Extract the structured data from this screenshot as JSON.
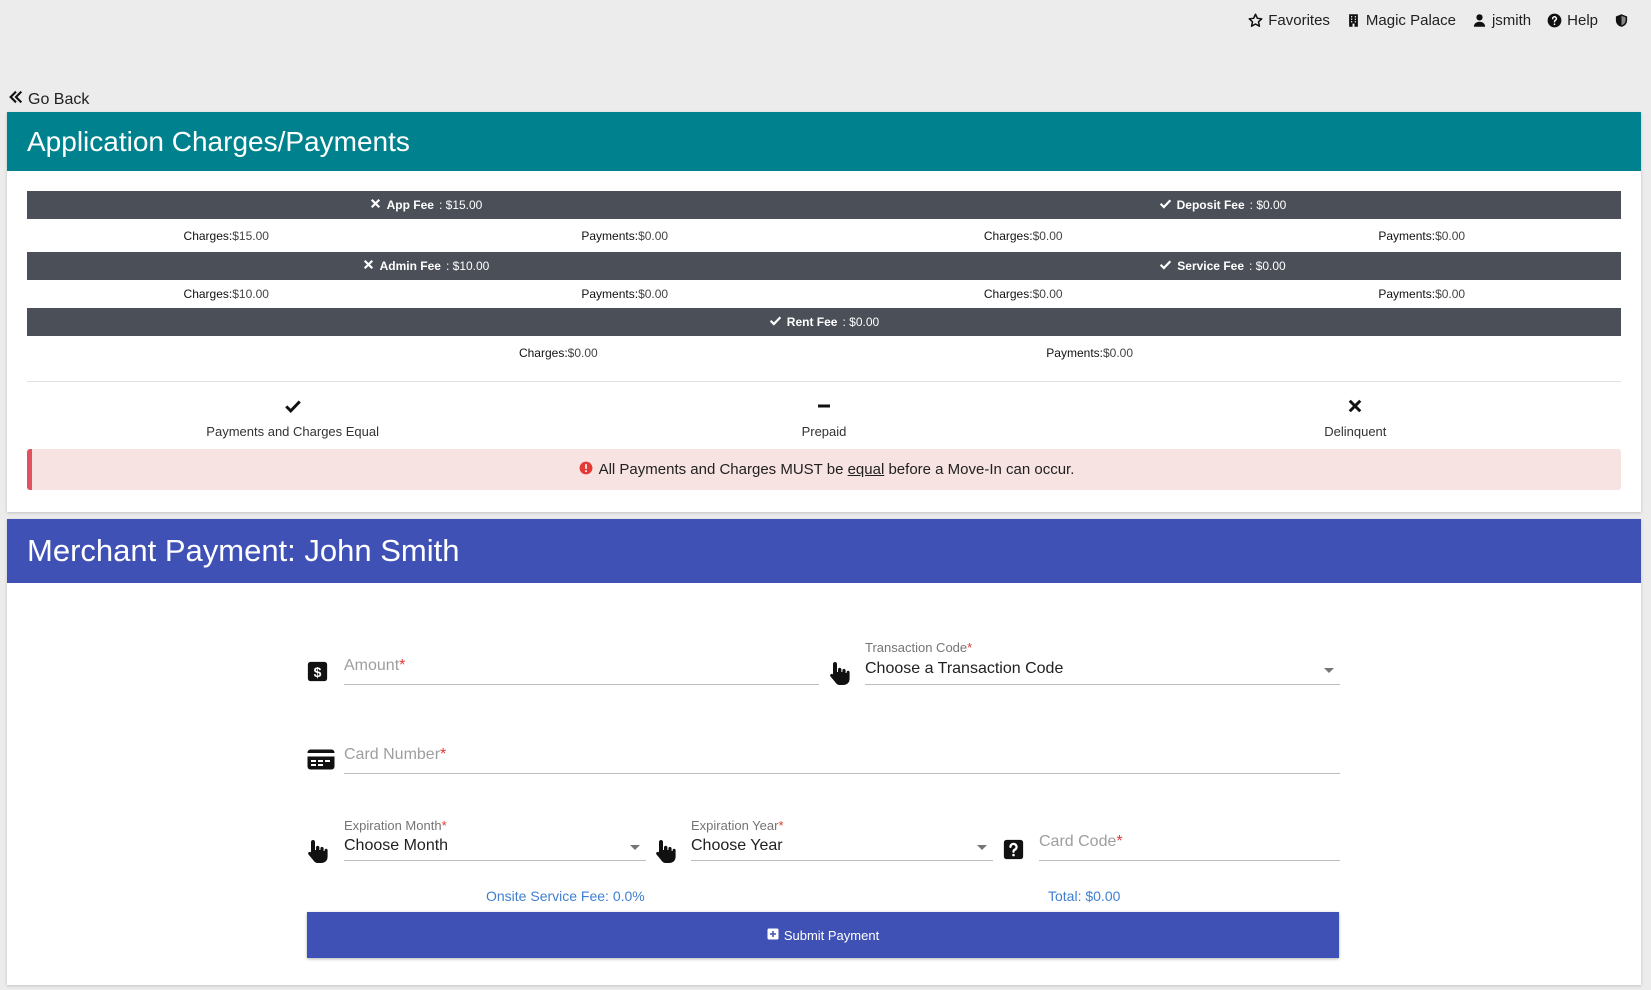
{
  "topnav": {
    "favorites": "Favorites",
    "property": "Magic Palace",
    "user": "jsmith",
    "help": "Help"
  },
  "go_back": "Go Back",
  "charges": {
    "title": "Application Charges/Payments",
    "charges_label": "Charges:",
    "payments_label": "Payments:",
    "fees": [
      {
        "name": "App Fee",
        "amount": ": $15.00",
        "status": "x",
        "charges": "$15.00",
        "payments": "$0.00"
      },
      {
        "name": "Deposit Fee",
        "amount": ": $0.00",
        "status": "check",
        "charges": "$0.00",
        "payments": "$0.00"
      },
      {
        "name": "Admin Fee",
        "amount": ": $10.00",
        "status": "x",
        "charges": "$10.00",
        "payments": "$0.00"
      },
      {
        "name": "Service Fee",
        "amount": ": $0.00",
        "status": "check",
        "charges": "$0.00",
        "payments": "$0.00"
      },
      {
        "name": "Rent Fee",
        "amount": ": $0.00",
        "status": "check",
        "charges": "$0.00",
        "payments": "$0.00"
      }
    ],
    "legend": {
      "equal": "Payments and Charges Equal",
      "prepaid": "Prepaid",
      "delinquent": "Delinquent"
    },
    "alert": {
      "before": "All Payments and Charges MUST be ",
      "emph": "equal",
      "after": " before a Move-In can occur."
    }
  },
  "merchant": {
    "title": "Merchant Payment: John Smith",
    "amount_placeholder": "Amount",
    "transaction_label": "Transaction Code",
    "transaction_value": "Choose a Transaction Code",
    "card_number_placeholder": "Card Number",
    "exp_month_label": "Expiration Month",
    "exp_month_value": "Choose Month",
    "exp_year_label": "Expiration Year",
    "exp_year_value": "Choose Year",
    "card_code_placeholder": "Card Code",
    "required_mark": "*",
    "onsite_fee": "Onsite Service Fee: 0.0%",
    "total": "Total: $0.00",
    "submit": "Submit Payment"
  },
  "colors": {
    "charges_header": "#00828e",
    "merchant_header": "#3f51b5",
    "fee_bar": "#4b4f58",
    "alert_bg": "#f8e3e3",
    "alert_border": "#e05260",
    "info_text": "#3f7fd0"
  }
}
